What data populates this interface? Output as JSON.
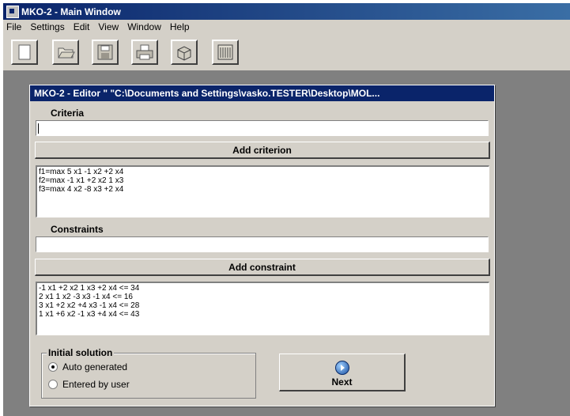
{
  "window": {
    "title": "MKO-2 - Main Window"
  },
  "menu": [
    "File",
    "Settings",
    "Edit",
    "View",
    "Window",
    "Help"
  ],
  "toolbar": {
    "buttons": [
      "new-file-icon",
      "open-folder-icon",
      "save-disk-icon",
      "print-icon",
      "package-icon",
      "calculator-icon"
    ]
  },
  "editor": {
    "title": "MKO-2 - Editor \" \"C:\\Documents and Settings\\vasko.TESTER\\Desktop\\MOL...",
    "criteria_label": "Criteria",
    "criteria_input_value": "",
    "add_criterion_label": "Add criterion",
    "criteria_list": [
      "f1=max 5 x1 -1 x2 +2 x4",
      "f2=max -1 x1 +2 x2 1 x3",
      "f3=max 4 x2 -8 x3 +2 x4"
    ],
    "constraints_label": "Constraints",
    "constraints_input_value": "",
    "add_constraint_label": "Add constraint",
    "constraints_list": [
      "-1 x1 +2 x2 1 x3 +2 x4 <= 34",
      "2 x1 1 x2 -3 x3 -1 x4 <= 16",
      "3 x1 +2 x2 +4 x3 -1 x4 <= 28",
      "1 x1 +6 x2 -1 x3 +4 x4 <= 43"
    ],
    "initial_solution": {
      "legend": "Initial solution",
      "options": [
        "Auto generated",
        "Entered by user"
      ],
      "selected": "Auto generated"
    },
    "next_label": "Next"
  }
}
